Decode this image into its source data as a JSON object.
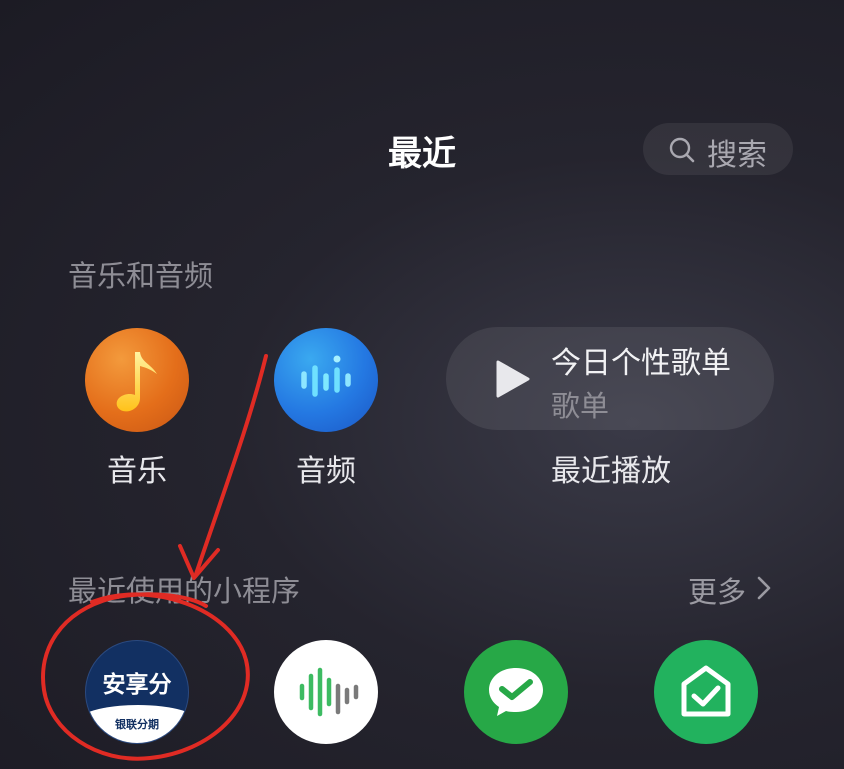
{
  "header": {
    "title": "最近",
    "search_label": "搜索"
  },
  "music_section": {
    "title": "音乐和音频",
    "apps": [
      {
        "label": "音乐",
        "icon": "music-note-icon",
        "color": "#e46e1a"
      },
      {
        "label": "音频",
        "icon": "audio-wave-icon",
        "color": "#2478e2"
      }
    ],
    "playlist_card": {
      "title": "今日个性歌单",
      "subtitle": "歌单",
      "caption": "最近播放",
      "icon": "play-icon"
    }
  },
  "mini_programs_section": {
    "title": "最近使用的小程序",
    "more_label": "更多",
    "items": [
      {
        "logo_text": "安享分",
        "logo_subtext": "银联分期",
        "label": "",
        "color": "#123062"
      },
      {
        "icon": "sound-wave-icon",
        "label": "",
        "color": "#ffffff"
      },
      {
        "icon": "wechat-pay-icon",
        "label": "",
        "color": "#27a847"
      },
      {
        "icon": "home-check-icon",
        "label": "",
        "color": "#22b25e"
      }
    ]
  },
  "annotation": {
    "color": "#e02b24",
    "shapes": [
      "arrow",
      "circle"
    ]
  }
}
